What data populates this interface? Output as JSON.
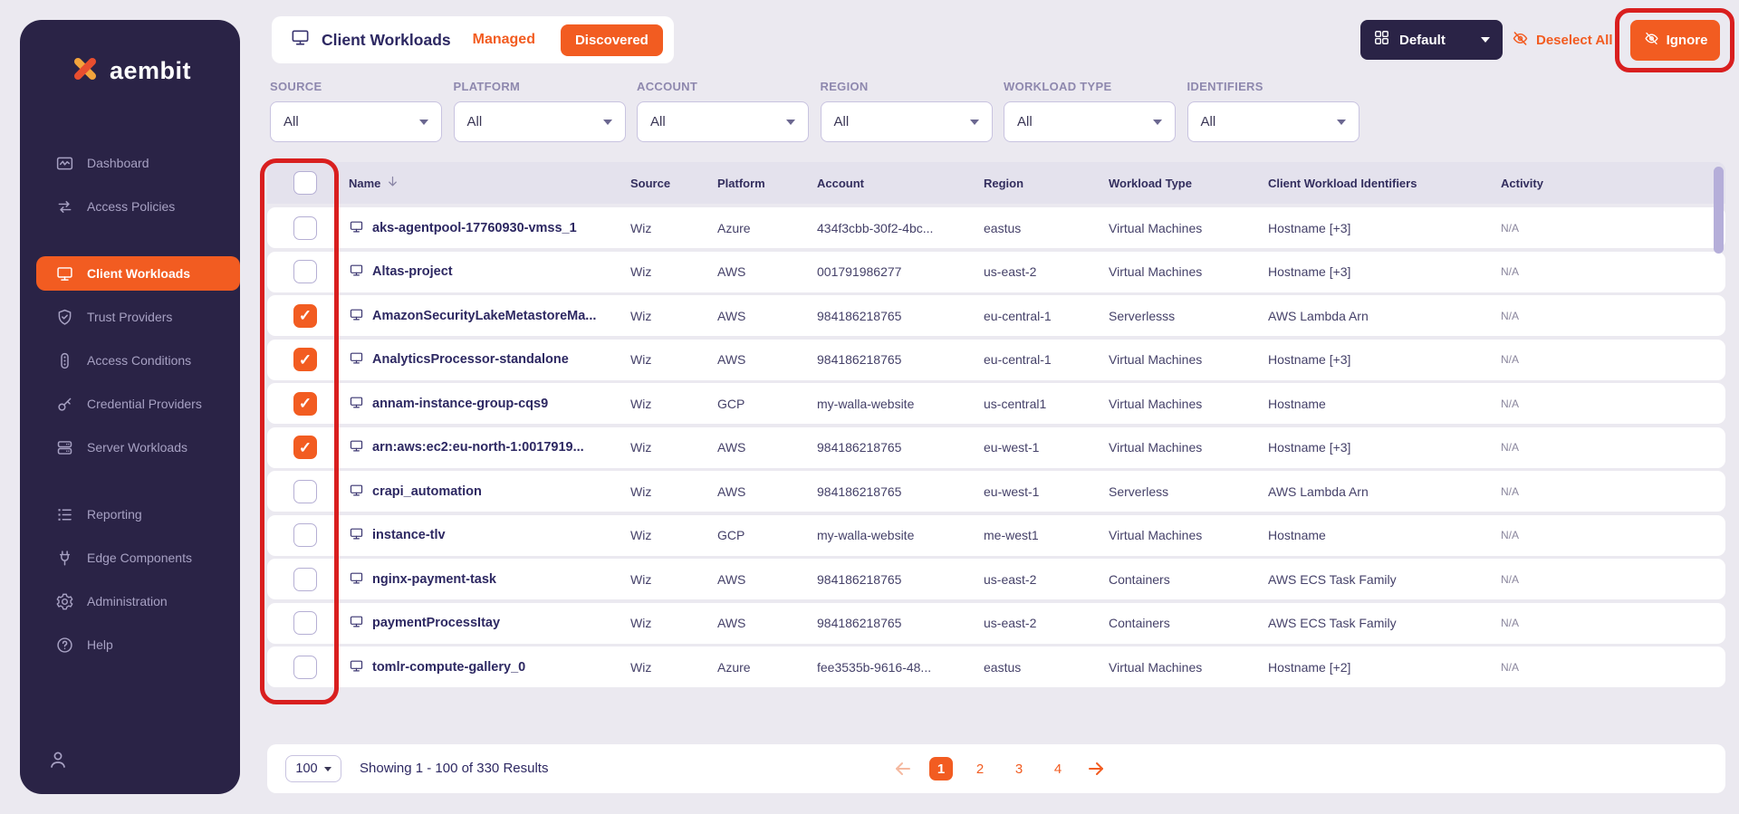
{
  "brand": {
    "logo_text": "aembit"
  },
  "sidebar": {
    "items": [
      {
        "label": "Dashboard",
        "icon": "dashboard",
        "active": false
      },
      {
        "label": "Access Policies",
        "icon": "access-policies",
        "active": false
      },
      {
        "label": "Client Workloads",
        "icon": "client-workloads",
        "active": true
      },
      {
        "label": "Trust Providers",
        "icon": "trust-providers",
        "active": false
      },
      {
        "label": "Access Conditions",
        "icon": "access-conditions",
        "active": false
      },
      {
        "label": "Credential Providers",
        "icon": "credential-providers",
        "active": false
      },
      {
        "label": "Server Workloads",
        "icon": "server-workloads",
        "active": false
      },
      {
        "label": "Reporting",
        "icon": "reporting",
        "active": false
      },
      {
        "label": "Edge Components",
        "icon": "edge-components",
        "active": false
      },
      {
        "label": "Administration",
        "icon": "administration",
        "active": false
      },
      {
        "label": "Help",
        "icon": "help",
        "active": false
      }
    ]
  },
  "header": {
    "title": "Client Workloads",
    "tab_managed": "Managed",
    "tab_discovered": "Discovered",
    "view_selector": "Default",
    "deselect_all": "Deselect All",
    "ignore": "Ignore"
  },
  "filters": [
    {
      "label": "SOURCE",
      "value": "All"
    },
    {
      "label": "PLATFORM",
      "value": "All"
    },
    {
      "label": "ACCOUNT",
      "value": "All"
    },
    {
      "label": "REGION",
      "value": "All"
    },
    {
      "label": "WORKLOAD TYPE",
      "value": "All"
    },
    {
      "label": "IDENTIFIERS",
      "value": "All"
    }
  ],
  "table": {
    "columns": [
      "Name",
      "Source",
      "Platform",
      "Account",
      "Region",
      "Workload Type",
      "Client Workload Identifiers",
      "Activity"
    ],
    "sorted_column": "Name",
    "rows": [
      {
        "checked": false,
        "name": "aks-agentpool-17760930-vmss_1",
        "source": "Wiz",
        "platform": "Azure",
        "account": "434f3cbb-30f2-4bc...",
        "region": "eastus",
        "workload_type": "Virtual Machines",
        "identifiers": "Hostname [+3]",
        "activity": "N/A"
      },
      {
        "checked": false,
        "name": "Altas-project",
        "source": "Wiz",
        "platform": "AWS",
        "account": "001791986277",
        "region": "us-east-2",
        "workload_type": "Virtual Machines",
        "identifiers": "Hostname [+3]",
        "activity": "N/A"
      },
      {
        "checked": true,
        "name": "AmazonSecurityLakeMetastoreMa...",
        "source": "Wiz",
        "platform": "AWS",
        "account": "984186218765",
        "region": "eu-central-1",
        "workload_type": "Serverlesss",
        "identifiers": "AWS Lambda Arn",
        "activity": "N/A"
      },
      {
        "checked": true,
        "name": "AnalyticsProcessor-standalone",
        "source": "Wiz",
        "platform": "AWS",
        "account": "984186218765",
        "region": "eu-central-1",
        "workload_type": "Virtual Machines",
        "identifiers": "Hostname [+3]",
        "activity": "N/A"
      },
      {
        "checked": true,
        "name": "annam-instance-group-cqs9",
        "source": "Wiz",
        "platform": "GCP",
        "account": "my-walla-website",
        "region": "us-central1",
        "workload_type": "Virtual Machines",
        "identifiers": "Hostname",
        "activity": "N/A"
      },
      {
        "checked": true,
        "name": "arn:aws:ec2:eu-north-1:0017919...",
        "source": "Wiz",
        "platform": "AWS",
        "account": "984186218765",
        "region": "eu-west-1",
        "workload_type": "Virtual Machines",
        "identifiers": "Hostname [+3]",
        "activity": "N/A"
      },
      {
        "checked": false,
        "name": "crapi_automation",
        "source": "Wiz",
        "platform": "AWS",
        "account": "984186218765",
        "region": "eu-west-1",
        "workload_type": "Serverless",
        "identifiers": "AWS Lambda Arn",
        "activity": "N/A"
      },
      {
        "checked": false,
        "name": "instance-tlv",
        "source": "Wiz",
        "platform": "GCP",
        "account": "my-walla-website",
        "region": "me-west1",
        "workload_type": "Virtual Machines",
        "identifiers": "Hostname",
        "activity": "N/A"
      },
      {
        "checked": false,
        "name": "nginx-payment-task",
        "source": "Wiz",
        "platform": "AWS",
        "account": "984186218765",
        "region": "us-east-2",
        "workload_type": "Containers",
        "identifiers": "AWS ECS Task Family",
        "activity": "N/A"
      },
      {
        "checked": false,
        "name": "paymentProcessItay",
        "source": "Wiz",
        "platform": "AWS",
        "account": "984186218765",
        "region": "us-east-2",
        "workload_type": "Containers",
        "identifiers": "AWS ECS Task Family",
        "activity": "N/A"
      },
      {
        "checked": false,
        "name": "tomlr-compute-gallery_0",
        "source": "Wiz",
        "platform": "Azure",
        "account": "fee3535b-9616-48...",
        "region": "eastus",
        "workload_type": "Virtual Machines",
        "identifiers": "Hostname [+2]",
        "activity": "N/A"
      }
    ]
  },
  "pagination": {
    "page_size": "100",
    "summary": "Showing 1 - 100 of 330 Results",
    "pages": [
      "1",
      "2",
      "3",
      "4"
    ],
    "active_page": "1"
  },
  "colors": {
    "accent_orange": "#f25c21",
    "sidebar_bg": "#2a2346",
    "page_bg": "#ebe9f0",
    "annotation_red": "#d91f1f",
    "header_row_bg": "#e4e2ed",
    "text_dark": "#2d2862"
  }
}
